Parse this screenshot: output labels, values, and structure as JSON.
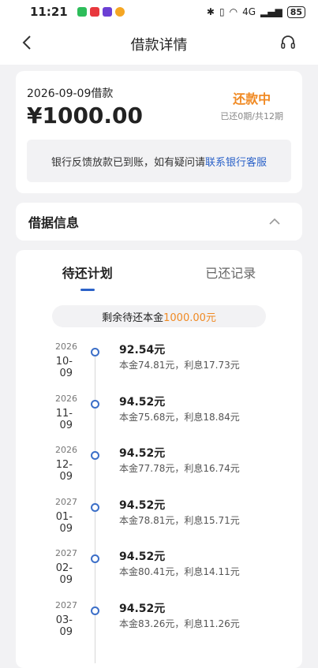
{
  "status_bar": {
    "time": "11:21",
    "battery": "85",
    "network": "4G"
  },
  "header": {
    "title": "借款详情"
  },
  "summary": {
    "loan_date": "2026-09-09借款",
    "amount": "¥1000.00",
    "status": "还款中",
    "progress": "已还0期/共12期",
    "notice_text": "银行反馈放款已到账，如有疑问请",
    "notice_link": "联系银行客服"
  },
  "info": {
    "title": "借据信息"
  },
  "plan": {
    "tabs": [
      "待还计划",
      "已还记录"
    ],
    "remaining_label": "剩余待还本金",
    "remaining_amount": "1000.00元",
    "rows": [
      {
        "year": "2026",
        "md": "10-09",
        "amount": "92.54元",
        "detail": "本金74.81元，利息17.73元"
      },
      {
        "year": "2026",
        "md": "11-09",
        "amount": "94.52元",
        "detail": "本金75.68元，利息18.84元"
      },
      {
        "year": "2026",
        "md": "12-09",
        "amount": "94.52元",
        "detail": "本金77.78元，利息16.74元"
      },
      {
        "year": "2027",
        "md": "01-09",
        "amount": "94.52元",
        "detail": "本金78.81元，利息15.71元"
      },
      {
        "year": "2027",
        "md": "02-09",
        "amount": "94.52元",
        "detail": "本金80.41元，利息14.11元"
      },
      {
        "year": "2027",
        "md": "03-09",
        "amount": "94.52元",
        "detail": "本金83.26元，利息11.26元"
      }
    ]
  }
}
